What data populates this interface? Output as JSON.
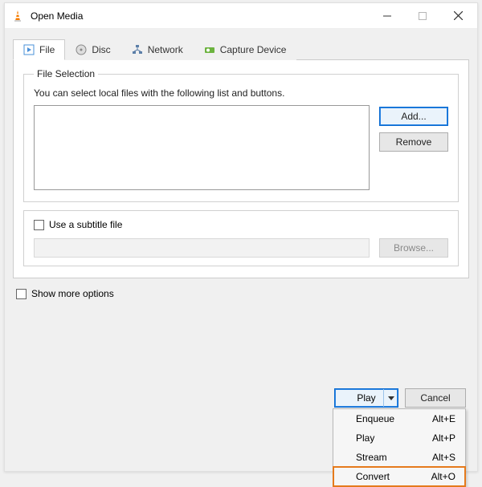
{
  "window": {
    "title": "Open Media"
  },
  "tabs": {
    "file": "File",
    "disc": "Disc",
    "network": "Network",
    "capture": "Capture Device"
  },
  "fileSelection": {
    "legend": "File Selection",
    "hint": "You can select local files with the following list and buttons.",
    "addLabel": "Add...",
    "removeLabel": "Remove"
  },
  "subtitle": {
    "checkboxLabel": "Use a subtitle file",
    "browseLabel": "Browse..."
  },
  "showMoreLabel": "Show more options",
  "footer": {
    "playLabel": "Play",
    "cancelLabel": "Cancel"
  },
  "dropdown": [
    {
      "label": "Enqueue",
      "shortcut": "Alt+E"
    },
    {
      "label": "Play",
      "shortcut": "Alt+P"
    },
    {
      "label": "Stream",
      "shortcut": "Alt+S"
    },
    {
      "label": "Convert",
      "shortcut": "Alt+O"
    }
  ]
}
